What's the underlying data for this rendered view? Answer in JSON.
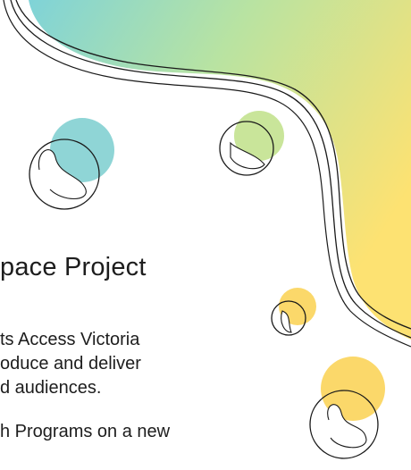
{
  "content": {
    "heading": "pace Project",
    "lines": [
      "ts Access Victoria",
      "oduce and deliver",
      "d audiences."
    ],
    "second_paragraph": "h Programs on a new"
  },
  "colors": {
    "background": "#ffffff",
    "gradient_start": "#7fd3d8",
    "gradient_end": "#fde272",
    "teal_blob": "#8fd5d6",
    "green_blob": "#c9e59a",
    "yellow_blob": "#fbd86a",
    "outline": "#1a1a1a"
  }
}
